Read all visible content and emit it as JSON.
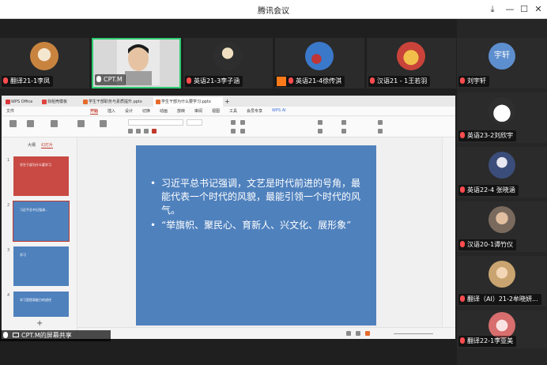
{
  "window": {
    "title": "腾讯会议"
  },
  "participants_top": [
    {
      "name": "翻译21-1李凤",
      "mic": "muted"
    },
    {
      "name": "CPT.M",
      "mic": "on"
    },
    {
      "name": "英语21-3李子涵",
      "mic": "muted"
    },
    {
      "name": "英语21-4徐传淇",
      "mic": "muted"
    },
    {
      "name": "汉语21 - 1王若羽",
      "mic": "muted"
    }
  ],
  "participants_side": [
    {
      "name": "刘宇轩",
      "avatar_text": "宇轩",
      "mic": "muted"
    },
    {
      "name": "英语23-2刘欣宇",
      "mic": "muted"
    },
    {
      "name": "英语22-4 张晓涵",
      "mic": "muted"
    },
    {
      "name": "汉语20-1谭竹仪",
      "mic": "muted"
    },
    {
      "name": "翻译（AI）21-2牟晓妍...",
      "mic": "muted"
    },
    {
      "name": "翻译22-1李亚美",
      "mic": "muted"
    }
  ],
  "wps": {
    "tabs": [
      "WPS Office",
      "找稻壳模板",
      "学生干部职务与素质提升.pptx",
      "学生干部为什么要学习.pptx"
    ],
    "menu": [
      "文件",
      "开始",
      "插入",
      "设计",
      "切换",
      "动画",
      "放映",
      "审阅",
      "视图",
      "工具",
      "会员专享",
      "WPS AI"
    ],
    "active_menu": "开始",
    "left_tabs": [
      "大纲",
      "幻灯片"
    ],
    "active_left_tab": "幻灯片",
    "thumbnails": [
      {
        "num": "1",
        "text": "学生干部为什么要学习"
      },
      {
        "num": "2",
        "text": "习近平总书记强调..."
      },
      {
        "num": "3",
        "text": "学习"
      },
      {
        "num": "4",
        "text": "学习是提高能力的途径"
      }
    ],
    "slide_bullets": [
      "习近平总书记强调，文艺是时代前进的号角，最能代表一个时代的风貌，最能引领一个时代的风气。",
      "“举旗帜、聚民心、育新人、兴文化、展形象”"
    ]
  },
  "share_bar": {
    "label": "CPT.M的屏幕共享"
  }
}
